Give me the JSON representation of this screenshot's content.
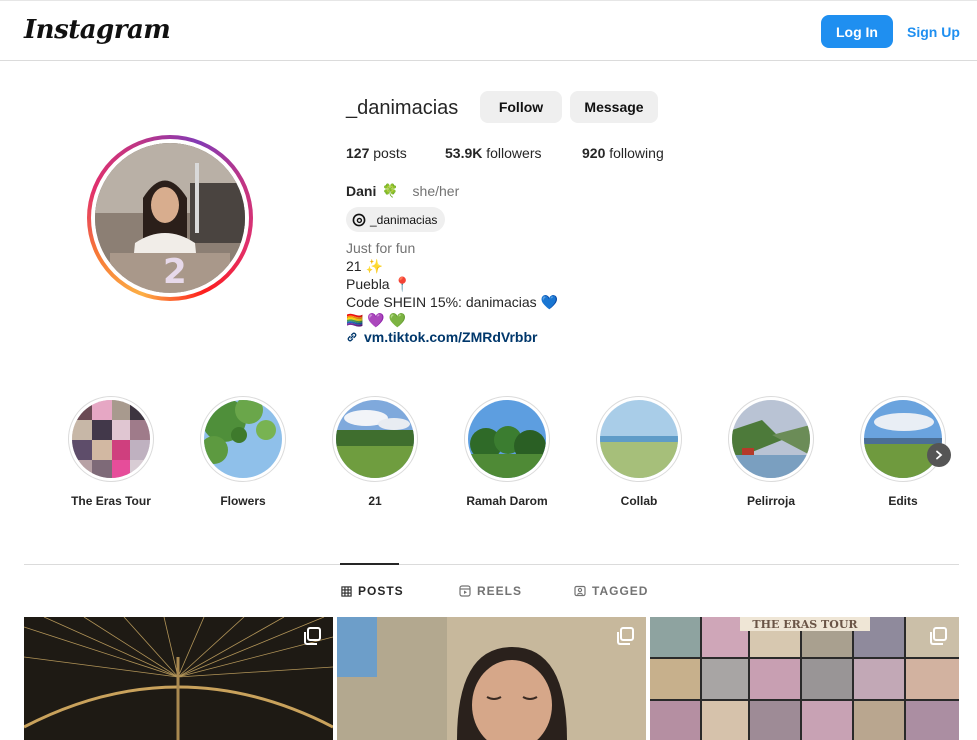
{
  "header": {
    "logo": "Instagram",
    "login_label": "Log In",
    "signup_label": "Sign Up"
  },
  "profile": {
    "username": "_danimacias",
    "follow_label": "Follow",
    "message_label": "Message",
    "stats": {
      "posts_count": "127",
      "posts_label": "posts",
      "followers_count": "53.9K",
      "followers_label": "followers",
      "following_count": "920",
      "following_label": "following"
    },
    "full_name": "Dani",
    "name_emoji": "🍀",
    "pronouns": "she/her",
    "threads_handle": "_danimacias",
    "bio": {
      "category": "Just for fun",
      "line1": "21 ✨",
      "line2": "Puebla 📍",
      "line3": "Code SHEIN 15%: danimacias 💙",
      "line4": "🏳️‍🌈 💜 💚"
    },
    "link": "vm.tiktok.com/ZMRdVrbbr"
  },
  "highlights": [
    {
      "label": "The Eras Tour"
    },
    {
      "label": "Flowers"
    },
    {
      "label": "21"
    },
    {
      "label": "Ramah Darom"
    },
    {
      "label": "Collab"
    },
    {
      "label": "Pelirroja"
    },
    {
      "label": "Edits"
    }
  ],
  "tabs": {
    "posts": "POSTS",
    "reels": "REELS",
    "tagged": "TAGGED"
  },
  "colors": {
    "primary_blue": "#1f8ff0",
    "link_blue": "#00376b",
    "button_gray": "#efefef",
    "border": "#dbdbdb"
  },
  "icons": {
    "threads": "threads-icon",
    "link": "link-icon",
    "grid": "grid-icon",
    "reels": "reels-icon",
    "tagged": "tagged-icon",
    "carousel": "carousel-icon",
    "chevron": "chevron-right-icon"
  }
}
